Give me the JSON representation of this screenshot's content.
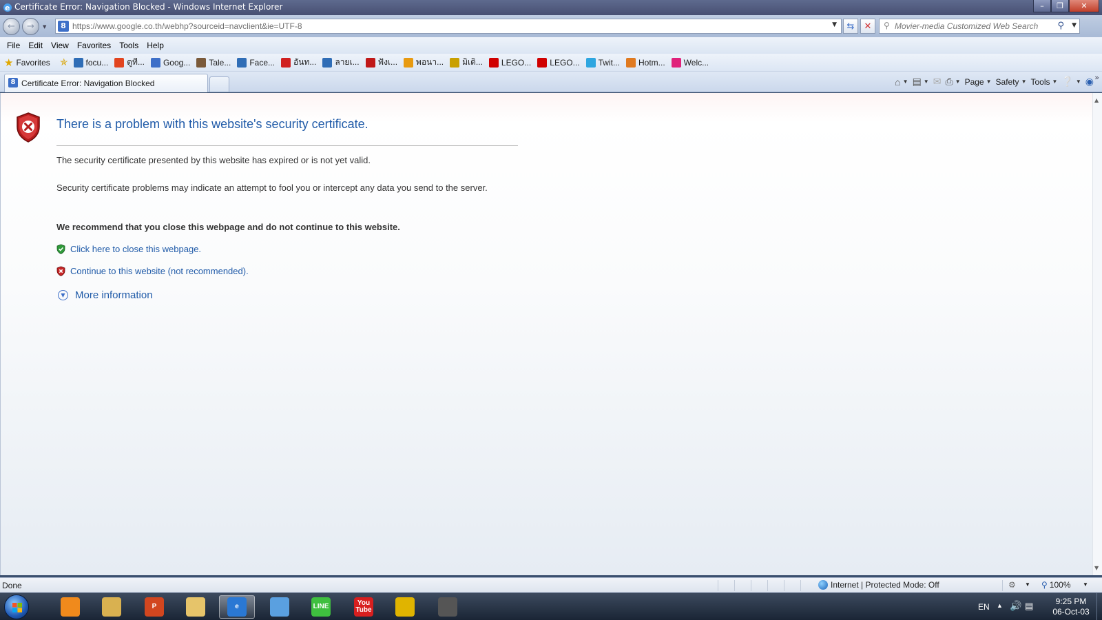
{
  "window": {
    "title": "Certificate Error: Navigation Blocked - Windows Internet Explorer",
    "minimize": "–",
    "restore": "❐",
    "close": "✕"
  },
  "navbar": {
    "url": "https://www.google.co.th/webhp?sourceid=navclient&ie=UTF-8",
    "favicon_letter": "8",
    "search_placeholder": "Movier-media Customized Web Search"
  },
  "menu": [
    "File",
    "Edit",
    "View",
    "Favorites",
    "Tools",
    "Help"
  ],
  "favorites_bar": {
    "favorites_label": "Favorites",
    "items": [
      {
        "label": "focu...",
        "color": "#2f6db6"
      },
      {
        "label": "ดูที...",
        "color": "#e2441f"
      },
      {
        "label": "Goog...",
        "color": "#3d6fc8"
      },
      {
        "label": "Tale...",
        "color": "#7a5a3a"
      },
      {
        "label": "Face...",
        "color": "#2f6db6"
      },
      {
        "label": "อันท...",
        "color": "#d02020"
      },
      {
        "label": "ลายเ...",
        "color": "#2f6db6"
      },
      {
        "label": "ฟังเ...",
        "color": "#c01818"
      },
      {
        "label": "พอนา...",
        "color": "#e89a10"
      },
      {
        "label": "มิเดิ...",
        "color": "#c9a000"
      },
      {
        "label": "LEGO...",
        "color": "#d00000"
      },
      {
        "label": "LEGO...",
        "color": "#d00000"
      },
      {
        "label": "Twit...",
        "color": "#2ea6e0"
      },
      {
        "label": "Hotm...",
        "color": "#e07a20"
      },
      {
        "label": "Welc...",
        "color": "#e0217a"
      }
    ]
  },
  "tabs": [
    {
      "label": "Certificate Error: Navigation Blocked",
      "active": true
    }
  ],
  "command_bar": {
    "page": "Page",
    "safety": "Safety",
    "tools": "Tools"
  },
  "content": {
    "title": "There is a problem with this website's security certificate.",
    "p1": "The security certificate presented by this website has expired or is not yet valid.",
    "p2": "Security certificate problems may indicate an attempt to fool you or intercept any data you send to the server.",
    "recommendation": "We recommend that you close this webpage and do not continue to this website.",
    "close_link": "Click here to close this webpage.",
    "continue_link": "Continue to this website (not recommended).",
    "more_info": "More information"
  },
  "statusbar": {
    "status": "Done",
    "zone": "Internet | Protected Mode: Off",
    "zoom": "100%"
  },
  "taskbar": {
    "apps": [
      {
        "name": "media-player-icon",
        "label": "",
        "color": "#f08a1c"
      },
      {
        "name": "explorer-docs-icon",
        "label": "",
        "color": "#d9b150"
      },
      {
        "name": "powerpoint-icon",
        "label": "P",
        "color": "#d2461f"
      },
      {
        "name": "folder-icon",
        "label": "",
        "color": "#e6c46a"
      },
      {
        "name": "internet-explorer-icon",
        "label": "e",
        "color": "#2a78d4",
        "active": true
      },
      {
        "name": "camera-app-icon",
        "label": "",
        "color": "#5aa0e0"
      },
      {
        "name": "line-icon",
        "label": "LINE",
        "color": "#3fbf3f"
      },
      {
        "name": "youtube-icon",
        "label": "You\nTube",
        "color": "#d81f1f"
      },
      {
        "name": "chrome-icon",
        "label": "",
        "color": "#e0b400"
      },
      {
        "name": "pen-tool-icon",
        "label": "",
        "color": "#555"
      }
    ],
    "lang": "EN",
    "time": "9:25 PM",
    "date": "06-Oct-03"
  }
}
